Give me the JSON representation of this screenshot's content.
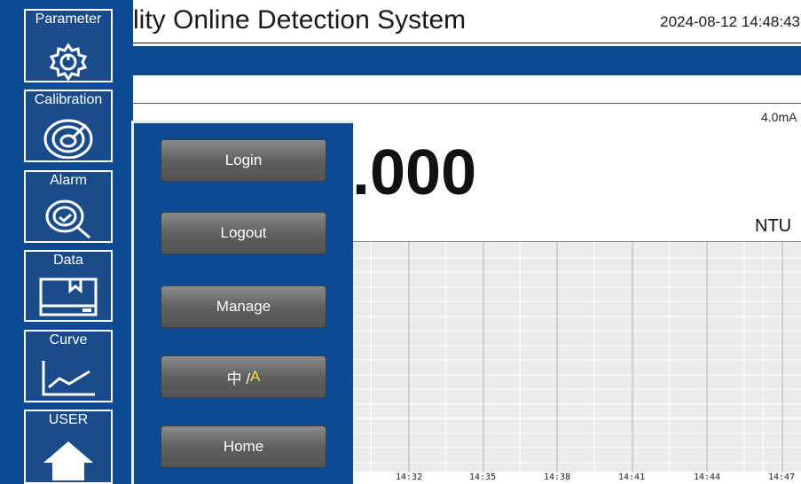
{
  "header": {
    "title": "lity Online Detection System",
    "datetime": "2024-08-12 14:48:43"
  },
  "sidebar": {
    "items": [
      {
        "label": "Parameter",
        "icon": "gear-icon"
      },
      {
        "label": "Calibration",
        "icon": "calibration-dial-icon"
      },
      {
        "label": "Alarm",
        "icon": "alarm-magnifier-icon"
      },
      {
        "label": "Data",
        "icon": "data-box-icon"
      },
      {
        "label": "Curve",
        "icon": "curve-chart-icon"
      },
      {
        "label": "USER",
        "icon": "home-icon"
      }
    ]
  },
  "reading": {
    "current": "4.0mA",
    "value": ".000",
    "unit": "NTU"
  },
  "trend": {
    "time_ticks": [
      "14:32",
      "14:35",
      "14:38",
      "14:41",
      "14:44",
      "14:47"
    ]
  },
  "menu": {
    "login": "Login",
    "logout": "Logout",
    "manage": "Manage",
    "lang_zh": "中 /",
    "lang_en": "A",
    "home": "Home"
  },
  "colors": {
    "primary_blue": "#0d4a93",
    "button_gray": "#6b6b6b",
    "lang_highlight": "#f2e23a"
  }
}
